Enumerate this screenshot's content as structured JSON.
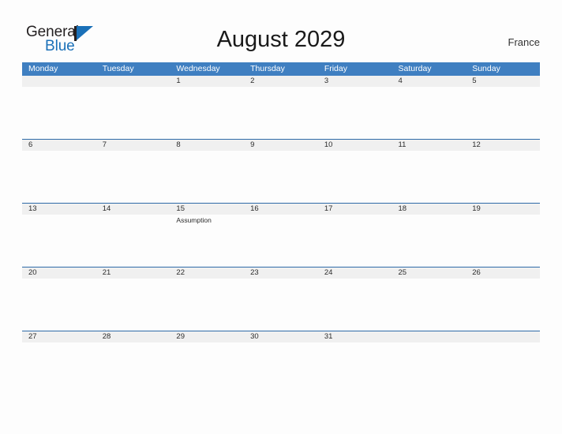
{
  "brand": {
    "name_part1": "General",
    "name_part2": "Blue",
    "accent_color": "#1a70b8",
    "logo_icon": "triangle-flag-icon"
  },
  "header": {
    "title": "August 2029",
    "month": "August",
    "year": "2029",
    "country": "France"
  },
  "calendar": {
    "header_bg": "#3f7fc1",
    "row_band_bg": "#f0f0f0",
    "row_border_color": "#2e6aa8",
    "weekday_headers": [
      "Monday",
      "Tuesday",
      "Wednesday",
      "Thursday",
      "Friday",
      "Saturday",
      "Sunday"
    ],
    "weeks": [
      {
        "days": [
          {
            "num": "",
            "events": []
          },
          {
            "num": "",
            "events": []
          },
          {
            "num": "1",
            "events": []
          },
          {
            "num": "2",
            "events": []
          },
          {
            "num": "3",
            "events": []
          },
          {
            "num": "4",
            "events": []
          },
          {
            "num": "5",
            "events": []
          }
        ]
      },
      {
        "days": [
          {
            "num": "6",
            "events": []
          },
          {
            "num": "7",
            "events": []
          },
          {
            "num": "8",
            "events": []
          },
          {
            "num": "9",
            "events": []
          },
          {
            "num": "10",
            "events": []
          },
          {
            "num": "11",
            "events": []
          },
          {
            "num": "12",
            "events": []
          }
        ]
      },
      {
        "days": [
          {
            "num": "13",
            "events": []
          },
          {
            "num": "14",
            "events": []
          },
          {
            "num": "15",
            "events": [
              "Assumption"
            ]
          },
          {
            "num": "16",
            "events": []
          },
          {
            "num": "17",
            "events": []
          },
          {
            "num": "18",
            "events": []
          },
          {
            "num": "19",
            "events": []
          }
        ]
      },
      {
        "days": [
          {
            "num": "20",
            "events": []
          },
          {
            "num": "21",
            "events": []
          },
          {
            "num": "22",
            "events": []
          },
          {
            "num": "23",
            "events": []
          },
          {
            "num": "24",
            "events": []
          },
          {
            "num": "25",
            "events": []
          },
          {
            "num": "26",
            "events": []
          }
        ]
      },
      {
        "days": [
          {
            "num": "27",
            "events": []
          },
          {
            "num": "28",
            "events": []
          },
          {
            "num": "29",
            "events": []
          },
          {
            "num": "30",
            "events": []
          },
          {
            "num": "31",
            "events": []
          },
          {
            "num": "",
            "events": []
          },
          {
            "num": "",
            "events": []
          }
        ]
      }
    ]
  }
}
